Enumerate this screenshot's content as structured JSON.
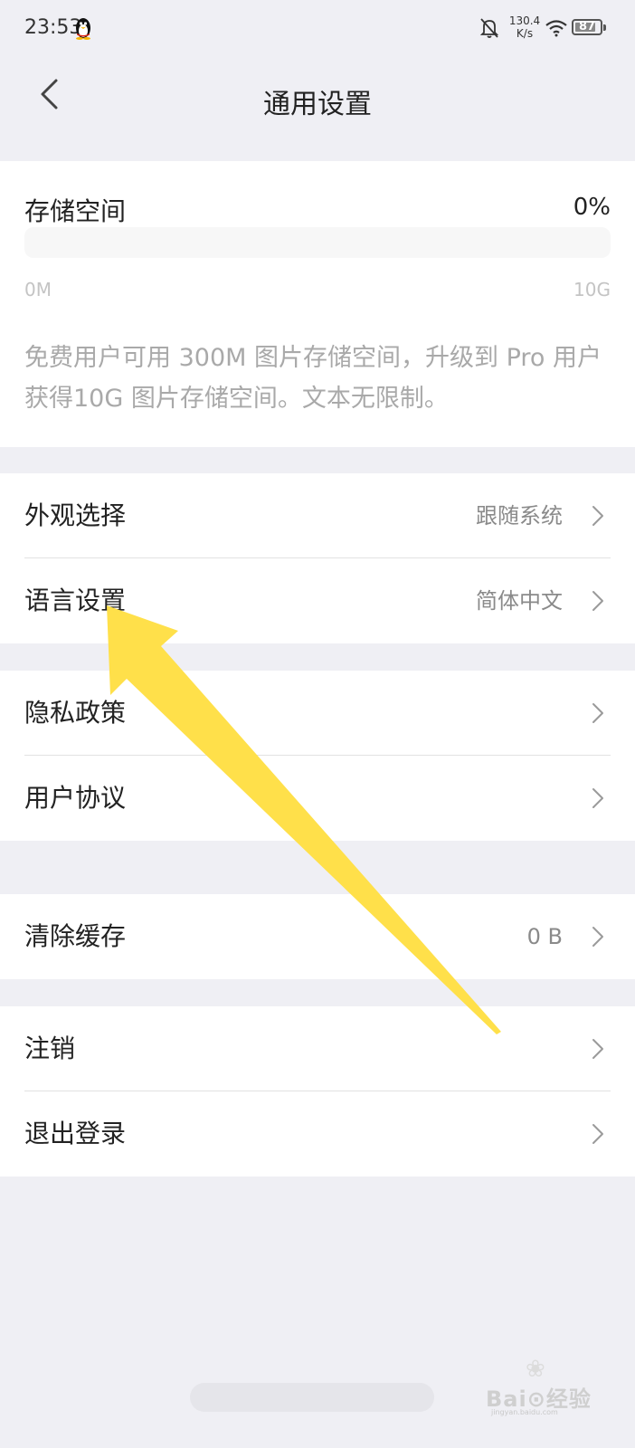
{
  "status_bar": {
    "time": "23:53",
    "net_speed_value": "130.4",
    "net_speed_unit": "K/s",
    "battery_level": "87",
    "battery_fraction": 0.87,
    "icons": [
      "qq-penguin-icon",
      "mute-bell-icon",
      "wifi-icon",
      "battery-icon"
    ]
  },
  "header": {
    "title": "通用设置",
    "back_icon": "chevron-left-icon"
  },
  "storage": {
    "label": "存储空间",
    "percent_text": "0%",
    "used_fraction": 0.0,
    "min_label": "0M",
    "max_label": "10G",
    "note": "免费用户可用 300M 图片存储空间，升级到 Pro 用户获得10G 图片存储空间。文本无限制。"
  },
  "sections": {
    "appearance": {
      "label": "外观选择",
      "value": "跟随系统"
    },
    "language": {
      "label": "语言设置",
      "value": "简体中文"
    },
    "privacy": {
      "label": "隐私政策",
      "value": ""
    },
    "agreement": {
      "label": "用户协议",
      "value": ""
    },
    "cache": {
      "label": "清除缓存",
      "value": "0 B"
    },
    "deregister": {
      "label": "注销",
      "value": ""
    },
    "logout": {
      "label": "退出登录",
      "value": ""
    }
  },
  "annotation": {
    "arrow_color": "#ffe04a"
  },
  "watermark": {
    "brand": "Bai⊙经验",
    "sub": "jingyan.baidu.com"
  },
  "colors": {
    "background": "#efeff4",
    "card": "#ffffff",
    "secondary_text": "#8a8a8a",
    "hint_text": "#a9a9a9"
  }
}
